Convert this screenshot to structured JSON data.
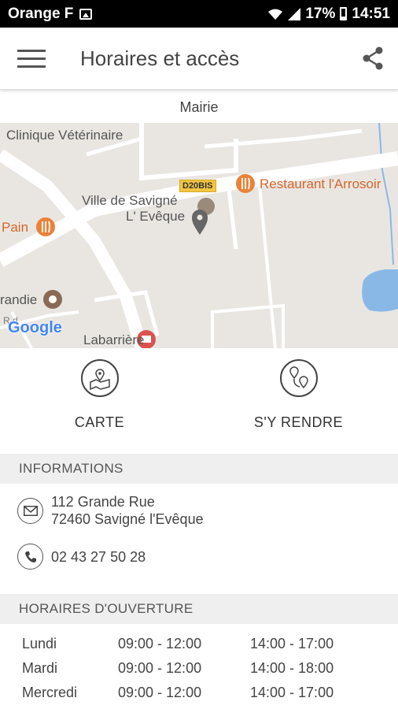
{
  "statusbar": {
    "carrier": "Orange F",
    "battery": "17%",
    "time": "14:51"
  },
  "appbar": {
    "title": "Horaires et accès",
    "menu_icon": "hamburger-icon",
    "share_icon": "share-icon"
  },
  "subtitle": "Mairie",
  "map": {
    "labels": {
      "clinique": "Clinique Vétérinaire",
      "road": "D20BIS",
      "restaurant": "Restaurant l'Arrosoir",
      "ville_line1": "Ville de Savigné",
      "ville_line2": "L' Evêque",
      "pain": "Pain",
      "grandie": "randie",
      "labarriere": "Labarrière",
      "google": "Google",
      "rd": "R d"
    }
  },
  "actions": {
    "carte": "CARTE",
    "sy_rendre": "S'Y RENDRE"
  },
  "informations": {
    "header": "INFORMATIONS",
    "address_line1": "112 Grande Rue",
    "address_line2": "72460 Savigné l'Evêque",
    "phone": "02 43 27 50 28"
  },
  "horaires": {
    "header": "HORAIRES D'OUVERTURE",
    "rows": [
      {
        "day": "Lundi",
        "am": "09:00 - 12:00",
        "pm": "14:00 - 17:00"
      },
      {
        "day": "Mardi",
        "am": "09:00 - 12:00",
        "pm": "14:00 - 18:00"
      },
      {
        "day": "Mercredi",
        "am": "09:00 - 12:00",
        "pm": "14:00 - 17:00"
      }
    ]
  },
  "colors": {
    "poi_orange": "#e8833a",
    "map_bg": "#e9e6e2",
    "water": "#8ab8e6",
    "section_bg": "#efefef"
  }
}
